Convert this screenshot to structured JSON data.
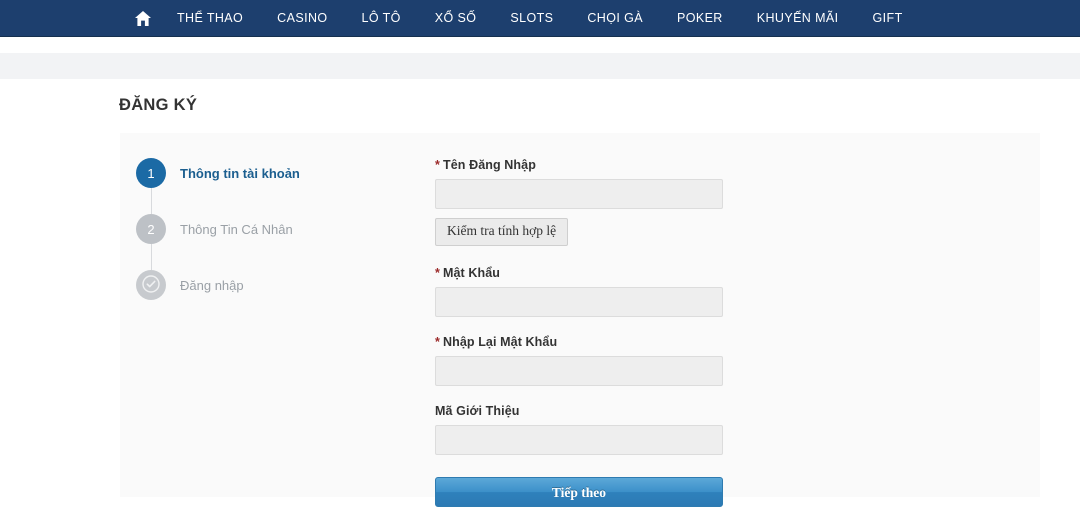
{
  "colors": {
    "nav_bg": "#1d3f6e",
    "strip_bg": "#f2f3f5",
    "panel_bg": "#fafafa",
    "accent_blue": "#1b6aa5",
    "step_muted": "#9aa0a6",
    "required_red": "#9c2a2a",
    "primary_button": "#3c90c9"
  },
  "nav": {
    "home_icon": "home-icon",
    "items": [
      {
        "label": "THỂ THAO"
      },
      {
        "label": "CASINO"
      },
      {
        "label": "LÔ TÔ"
      },
      {
        "label": "XỔ SỐ"
      },
      {
        "label": "SLOTS"
      },
      {
        "label": "CHỌI GÀ"
      },
      {
        "label": "POKER"
      },
      {
        "label": "KHUYẾN MÃI"
      },
      {
        "label": "GIFT"
      }
    ]
  },
  "page": {
    "title": "ĐĂNG KÝ"
  },
  "steps": [
    {
      "number": "1",
      "label": "Thông tin tài khoản",
      "state": "active"
    },
    {
      "number": "2",
      "label": "Thông Tin Cá Nhân",
      "state": "inactive"
    },
    {
      "icon": "check-circle-icon",
      "label": "Đăng nhập",
      "state": "done"
    }
  ],
  "form": {
    "username": {
      "required_mark": "*",
      "label": "Tên Đăng Nhập",
      "value": "",
      "placeholder": ""
    },
    "check_button": {
      "label": "Kiểm tra tính hợp lệ"
    },
    "password": {
      "required_mark": "*",
      "label": "Mật Khẩu",
      "value": "",
      "placeholder": ""
    },
    "confirm_password": {
      "required_mark": "*",
      "label": "Nhập Lại Mật Khẩu",
      "value": "",
      "placeholder": ""
    },
    "referral": {
      "label": "Mã Giới Thiệu",
      "value": "",
      "placeholder": ""
    },
    "submit_button": {
      "label": "Tiếp theo"
    }
  }
}
